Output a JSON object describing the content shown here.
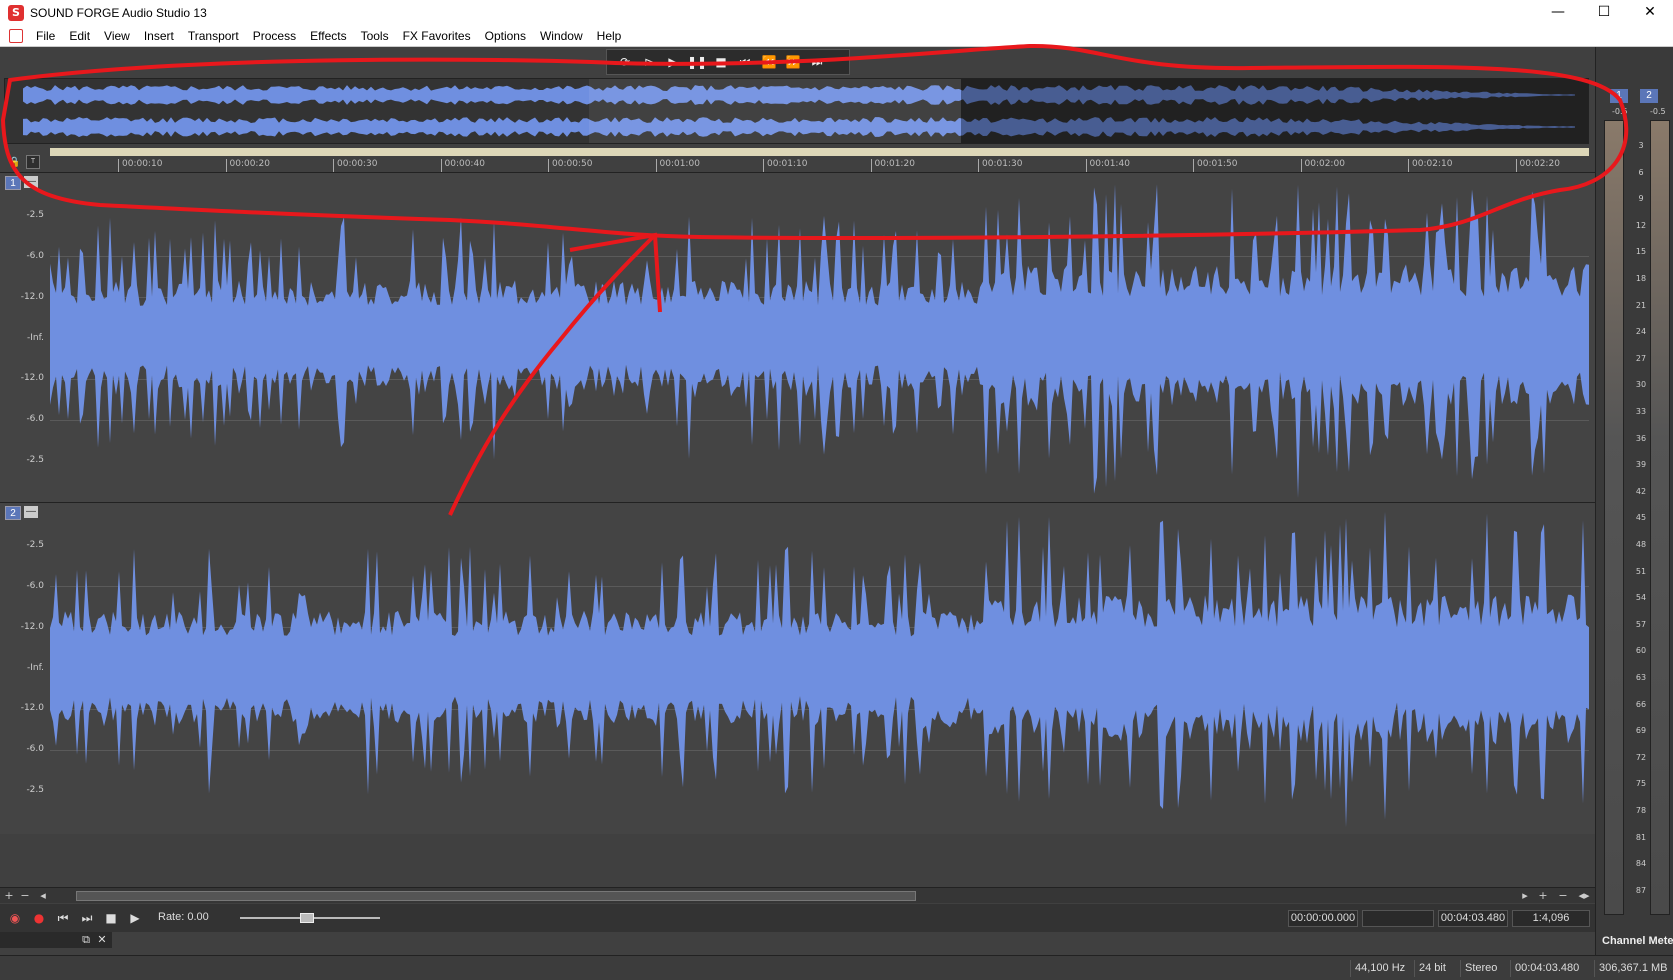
{
  "window": {
    "title": "SOUND FORGE Audio Studio 13",
    "controls": {
      "minimize": "—",
      "maximize": "☐",
      "close": "✕"
    }
  },
  "menu": [
    "File",
    "Edit",
    "View",
    "Insert",
    "Transport",
    "Process",
    "Effects",
    "Tools",
    "FX Favorites",
    "Options",
    "Window",
    "Help"
  ],
  "mdi_controls": {
    "minimize": "_",
    "restore": "▫",
    "close": "✕"
  },
  "transport_top": {
    "icons": [
      "loop-icon",
      "play-from-start-icon",
      "play-icon",
      "pause-icon",
      "stop-icon",
      "go-to-start-icon",
      "rewind-icon",
      "fast-forward-icon",
      "go-to-end-icon"
    ],
    "glyphs": [
      "⟳",
      "⊳",
      "▶",
      "❚❚",
      "■",
      "⏮",
      "⏪",
      "⏩",
      "⏭"
    ]
  },
  "ruler": {
    "labels": [
      "00:00:10",
      "00:00:20",
      "00:00:30",
      "00:00:40",
      "00:00:50",
      "00:01:00",
      "00:01:10",
      "00:01:20",
      "00:01:30",
      "00:01:40",
      "00:01:50",
      "00:02:00",
      "00:02:10",
      "00:02:20"
    ]
  },
  "channels": [
    {
      "number": "1",
      "collapse": "—",
      "db_labels": [
        "-2.5",
        "-6.0",
        "-12.0",
        "-Inf.",
        "-12.0",
        "-6.0",
        "-2.5"
      ]
    },
    {
      "number": "2",
      "collapse": "—",
      "db_labels": [
        "-2.5",
        "-6.0",
        "-12.0",
        "-Inf.",
        "-12.0",
        "-6.0",
        "-2.5"
      ]
    }
  ],
  "waveform_color": "#6f8fe0",
  "annotation_color": "#e8181c",
  "hscroll": {
    "left": [
      "+",
      "−",
      "◂"
    ],
    "right": [
      "▸",
      "+",
      "−",
      "◂▸"
    ]
  },
  "bottom_transport": {
    "icons": [
      "record-arm-icon",
      "record-icon",
      "go-to-start-icon",
      "go-to-end-icon",
      "stop-icon",
      "play-icon"
    ],
    "glyphs": [
      "◉",
      "●",
      "⏮",
      "⏭",
      "■",
      "▶"
    ],
    "rate_label": "Rate: 0.00",
    "rate": 0.5,
    "time_boxes": [
      "00:00:00.000",
      "",
      "00:04:03.480",
      "1:4,096"
    ]
  },
  "doc_tab": {
    "restore": "⧉",
    "close": "✕"
  },
  "status": [
    "44,100 Hz",
    "24 bit",
    "Stereo",
    "00:04:03.480",
    "306,367.1 MB"
  ],
  "meters": {
    "badges": [
      "1",
      "2"
    ],
    "peak": [
      "-0.5",
      "-0.5"
    ],
    "scale": [
      "3",
      "6",
      "9",
      "12",
      "15",
      "18",
      "21",
      "24",
      "27",
      "30",
      "33",
      "36",
      "39",
      "42",
      "45",
      "48",
      "51",
      "54",
      "57",
      "60",
      "63",
      "66",
      "69",
      "72",
      "75",
      "78",
      "81",
      "84",
      "87"
    ],
    "title": "Channel Meters"
  }
}
